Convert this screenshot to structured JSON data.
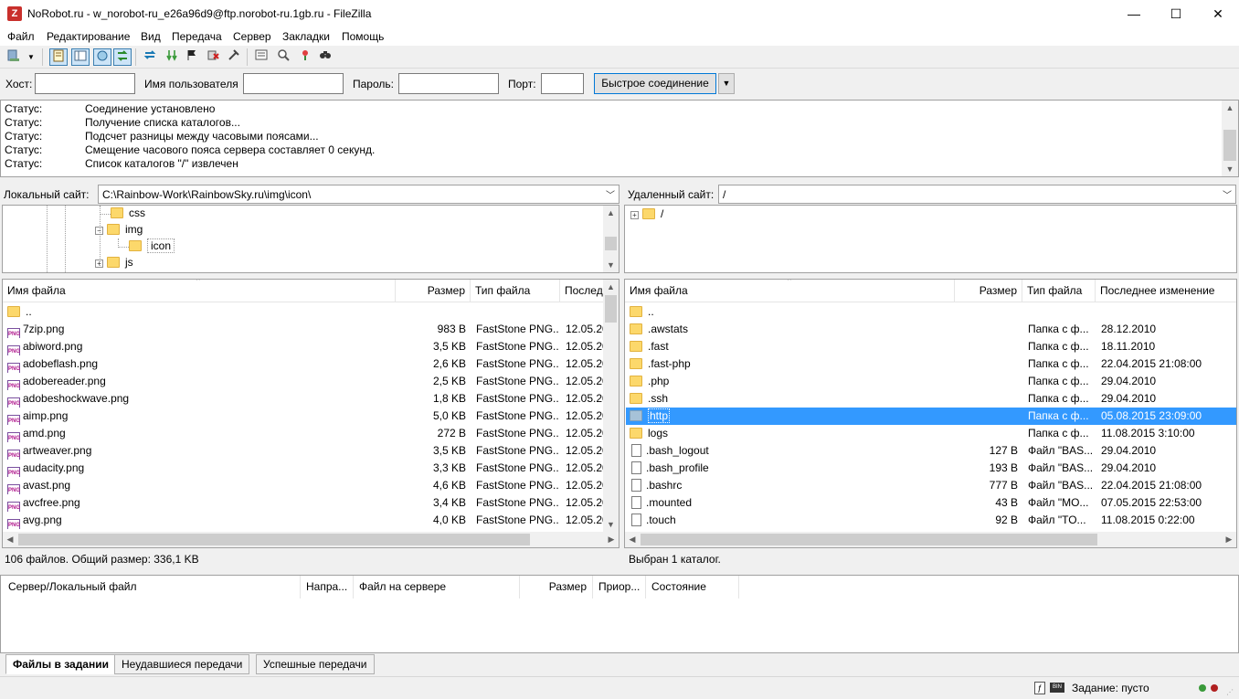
{
  "window": {
    "title": "NoRobot.ru - w_norobot-ru_e26a96d9@ftp.norobot-ru.1gb.ru - FileZilla",
    "app_icon": "Z",
    "minimize": "—",
    "maximize": "☐",
    "close": "✕"
  },
  "menu": [
    "Файл",
    "Редактирование",
    "Вид",
    "Передача",
    "Сервер",
    "Закладки",
    "Помощь"
  ],
  "quickconnect": {
    "host_label": "Хост:",
    "host_value": "",
    "user_label": "Имя пользователя",
    "user_value": "",
    "pass_label": "Пароль:",
    "pass_value": "",
    "port_label": "Порт:",
    "port_value": "",
    "connect_button": "Быстрое соединение"
  },
  "log": [
    {
      "label": "Статус:",
      "text": "Соединение установлено"
    },
    {
      "label": "Статус:",
      "text": "Получение списка каталогов..."
    },
    {
      "label": "Статус:",
      "text": "Подсчет разницы между часовыми поясами..."
    },
    {
      "label": "Статус:",
      "text": "Смещение часового пояса сервера составляет 0 секунд."
    },
    {
      "label": "Статус:",
      "text": "Список каталогов \"/\" извлечен"
    }
  ],
  "local": {
    "site_label": "Локальный сайт:",
    "site_path": "C:\\Rainbow-Work\\RainbowSky.ru\\img\\icon\\",
    "tree": [
      {
        "name": "css",
        "expander": ""
      },
      {
        "name": "img",
        "expander": "−"
      },
      {
        "name": "icon",
        "expander": ""
      },
      {
        "name": "js",
        "expander": "+"
      }
    ],
    "columns": [
      "Имя файла",
      "Размер",
      "Тип файла",
      "Послед"
    ],
    "files": [
      {
        "name": "..",
        "size": "",
        "type": "",
        "modified": "",
        "kind": "folder"
      },
      {
        "name": "7zip.png",
        "size": "983 B",
        "type": "FastStone PNG...",
        "modified": "12.05.20",
        "kind": "png"
      },
      {
        "name": "abiword.png",
        "size": "3,5 KB",
        "type": "FastStone PNG...",
        "modified": "12.05.20",
        "kind": "png"
      },
      {
        "name": "adobeflash.png",
        "size": "2,6 KB",
        "type": "FastStone PNG...",
        "modified": "12.05.20",
        "kind": "png"
      },
      {
        "name": "adobereader.png",
        "size": "2,5 KB",
        "type": "FastStone PNG...",
        "modified": "12.05.20",
        "kind": "png"
      },
      {
        "name": "adobeshockwave.png",
        "size": "1,8 KB",
        "type": "FastStone PNG...",
        "modified": "12.05.20",
        "kind": "png"
      },
      {
        "name": "aimp.png",
        "size": "5,0 KB",
        "type": "FastStone PNG...",
        "modified": "12.05.20",
        "kind": "png"
      },
      {
        "name": "amd.png",
        "size": "272 B",
        "type": "FastStone PNG...",
        "modified": "12.05.20",
        "kind": "png"
      },
      {
        "name": "artweaver.png",
        "size": "3,5 KB",
        "type": "FastStone PNG...",
        "modified": "12.05.20",
        "kind": "png"
      },
      {
        "name": "audacity.png",
        "size": "3,3 KB",
        "type": "FastStone PNG...",
        "modified": "12.05.20",
        "kind": "png"
      },
      {
        "name": "avast.png",
        "size": "4,6 KB",
        "type": "FastStone PNG...",
        "modified": "12.05.20",
        "kind": "png"
      },
      {
        "name": "avcfree.png",
        "size": "3,4 KB",
        "type": "FastStone PNG...",
        "modified": "12.05.20",
        "kind": "png"
      },
      {
        "name": "avg.png",
        "size": "4,0 KB",
        "type": "FastStone PNG...",
        "modified": "12.05.20",
        "kind": "png"
      }
    ],
    "status": "106 файлов. Общий размер: 336,1 KB"
  },
  "remote": {
    "site_label": "Удаленный сайт:",
    "site_path": "/",
    "tree": [
      {
        "name": "/",
        "expander": "+"
      }
    ],
    "columns": [
      "Имя файла",
      "Размер",
      "Тип файла",
      "Последнее изменение"
    ],
    "files": [
      {
        "name": "..",
        "size": "",
        "type": "",
        "modified": "",
        "kind": "folder"
      },
      {
        "name": ".awstats",
        "size": "",
        "type": "Папка с ф...",
        "modified": "28.12.2010",
        "kind": "folder"
      },
      {
        "name": ".fast",
        "size": "",
        "type": "Папка с ф...",
        "modified": "18.11.2010",
        "kind": "folder"
      },
      {
        "name": ".fast-php",
        "size": "",
        "type": "Папка с ф...",
        "modified": "22.04.2015 21:08:00",
        "kind": "folder"
      },
      {
        "name": ".php",
        "size": "",
        "type": "Папка с ф...",
        "modified": "29.04.2010",
        "kind": "folder"
      },
      {
        "name": ".ssh",
        "size": "",
        "type": "Папка с ф...",
        "modified": "29.04.2010",
        "kind": "folder"
      },
      {
        "name": "http",
        "size": "",
        "type": "Папка с ф...",
        "modified": "05.08.2015 23:09:00",
        "kind": "folder",
        "selected": true
      },
      {
        "name": "logs",
        "size": "",
        "type": "Папка с ф...",
        "modified": "11.08.2015 3:10:00",
        "kind": "folder"
      },
      {
        "name": ".bash_logout",
        "size": "127 B",
        "type": "Файл \"BAS...",
        "modified": "29.04.2010",
        "kind": "file"
      },
      {
        "name": ".bash_profile",
        "size": "193 B",
        "type": "Файл \"BAS...",
        "modified": "29.04.2010",
        "kind": "file"
      },
      {
        "name": ".bashrc",
        "size": "777 B",
        "type": "Файл \"BAS...",
        "modified": "22.04.2015 21:08:00",
        "kind": "file"
      },
      {
        "name": ".mounted",
        "size": "43 B",
        "type": "Файл \"MO...",
        "modified": "07.05.2015 22:53:00",
        "kind": "file"
      },
      {
        "name": ".touch",
        "size": "92 B",
        "type": "Файл \"TO...",
        "modified": "11.08.2015 0:22:00",
        "kind": "file"
      }
    ],
    "status": "Выбран 1 каталог."
  },
  "queue": {
    "columns": [
      "Сервер/Локальный файл",
      "Напра...",
      "Файл на сервере",
      "Размер",
      "Приор...",
      "Состояние"
    ]
  },
  "tabs": [
    "Файлы в задании",
    "Неудавшиеся передачи",
    "Успешные передачи"
  ],
  "bottom": {
    "queue_status": "Задание: пусто",
    "mode_badge": "BIN"
  },
  "colors": {
    "selection": "#3399ff",
    "close_button": "#e81123",
    "folder": "#fcd86b",
    "led_green": "#3a9a3a",
    "led_red": "#b02020"
  }
}
